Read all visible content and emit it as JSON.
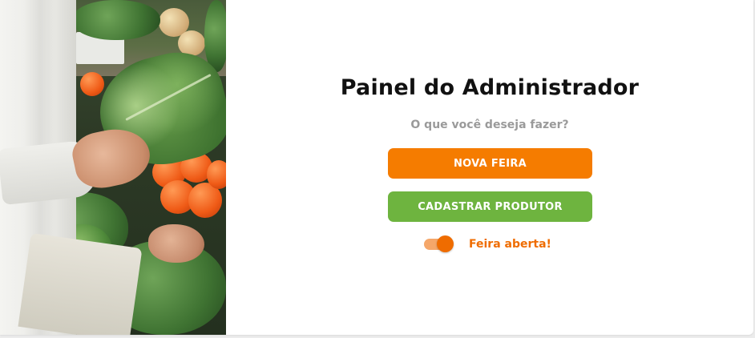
{
  "header": {
    "title": "Painel do Administrador",
    "subtitle": "O que você deseja fazer?"
  },
  "actions": {
    "new_fair_label": "NOVA FEIRA",
    "register_producer_label": "CADASTRAR PRODUTOR"
  },
  "fair_status": {
    "label": "Feira aberta!",
    "toggle_on": true
  },
  "colors": {
    "accent_orange": "#f57c00",
    "accent_green": "#6eb43f",
    "toggle_track": "#f5a76a",
    "toggle_thumb": "#ef6c00"
  },
  "photo": {
    "icon": "vegetables-photo"
  }
}
